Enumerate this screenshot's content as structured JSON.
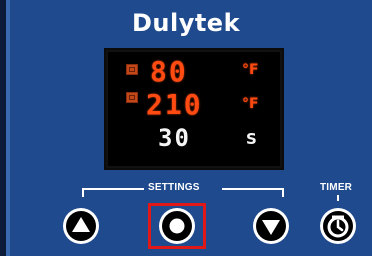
{
  "brand": {
    "name": "Dulytek"
  },
  "display": {
    "row1": {
      "value": "80",
      "unit": "°F"
    },
    "row2": {
      "value": "210",
      "unit": "°F"
    },
    "row3": {
      "value": "30",
      "unit": "S"
    }
  },
  "controls": {
    "settings_label": "SETTINGS",
    "timer_label": "TIMER"
  },
  "colors": {
    "panel": "#1f4b8e",
    "display_red": "#ff4a12",
    "highlight": "#e01818"
  }
}
